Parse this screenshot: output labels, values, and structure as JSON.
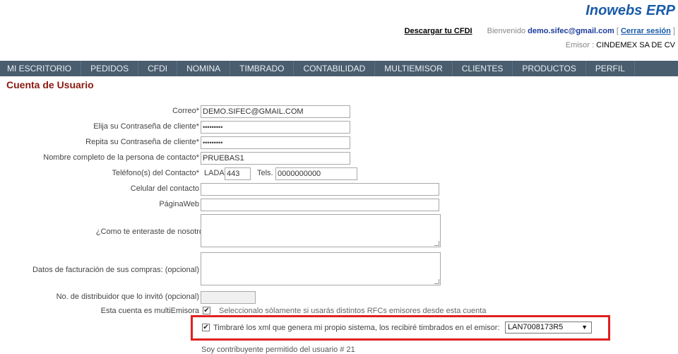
{
  "header": {
    "brand": "Inowebs ERP",
    "download_link": "Descargar tu CFDI",
    "welcome": "Bienvenido",
    "email": "demo.sifec@gmail.com",
    "logout_open": "[ ",
    "logout": "Cerrar sesión",
    "logout_close": " ]",
    "emisor_label": "Emisor : ",
    "emisor_value": "CINDEMEX SA DE CV"
  },
  "nav": [
    "MI ESCRITORIO",
    "PEDIDOS",
    "CFDI",
    "NOMINA",
    "TIMBRADO",
    "CONTABILIDAD",
    "MULTIEMISOR",
    "CLIENTES",
    "PRODUCTOS",
    "PERFIL"
  ],
  "page_title": "Cuenta de Usuario",
  "form": {
    "correo_label": "Correo*",
    "correo_value": "DEMO.SIFEC@GMAIL.COM",
    "pass_label": "Elija su Contraseña de cliente*",
    "pass_value": "•••••••••",
    "pass2_label": "Repita su Contraseña de cliente*",
    "pass2_value": "•••••••••",
    "nombre_label": "Nombre completo de la persona de contacto*",
    "nombre_value": "PRUEBAS1",
    "tel_label": "Teléfono(s) del Contacto*",
    "lada_label": "LADA",
    "lada_value": "443",
    "tels_label": "Tels.",
    "tels_value": "0000000000",
    "celular_label": "Celular del contacto",
    "web_label": "PáginaWeb",
    "enteraste_label": "¿Como te enteraste de nosotros? *",
    "facturacion_label": "Datos de facturación de sus compras: (opcional)",
    "distribuidor_label": "No. de distribuidor que lo invitó (opcional)",
    "multi_label": "Esta cuenta es multiEmisora",
    "multi_hint": "Seleccionalo sólamente si usarás distintos RFCs emisores desde esta cuenta",
    "timbrare_label": "Timbraré los xml que genera mi propio sistema, los recibiré timbrados en el emisor:",
    "timbrare_select": "LAN7008173R5",
    "contribuyente": "Soy contribuyente permitido del usuario # 21"
  }
}
